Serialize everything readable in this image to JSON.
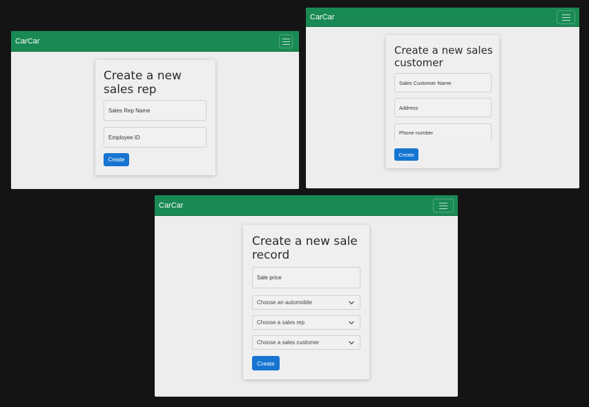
{
  "app": {
    "brand": "CarCar"
  },
  "sales_rep_form": {
    "title": "Create a new sales rep",
    "name_placeholder": "Sales Rep Name",
    "employee_id_placeholder": "Employee ID",
    "submit_label": "Create"
  },
  "sales_customer_form": {
    "title": "Create a new sales customer",
    "name_placeholder": "Sales Customer Name",
    "address_placeholder": "Address",
    "phone_placeholder": "Phone number",
    "submit_label": "Create"
  },
  "sale_record_form": {
    "title": "Create a new sale record",
    "price_placeholder": "Sale price",
    "automobile_select": "Choose an automobile",
    "sales_rep_select": "Choose a sales rep",
    "customer_select": "Choose a sales customer",
    "submit_label": "Create"
  },
  "icons": {
    "menu": "hamburger-menu-icon",
    "dropdown": "chevron-down-icon"
  },
  "colors": {
    "navbar": "#1a8a54",
    "button": "#1775d1",
    "background": "#141414",
    "page": "#ededed"
  }
}
